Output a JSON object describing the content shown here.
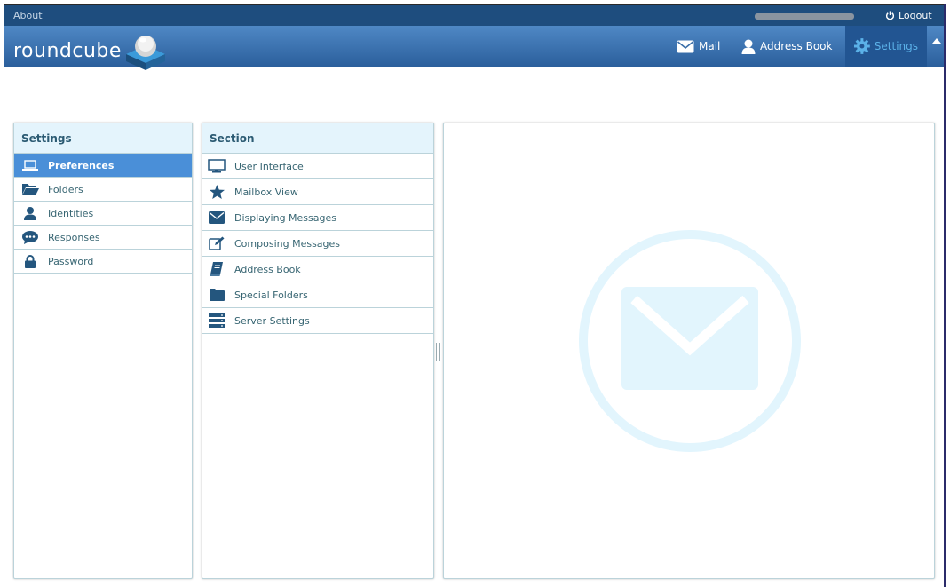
{
  "topline": {
    "about": "About",
    "logout": "Logout"
  },
  "header": {
    "logo_text": "roundcube",
    "nav": {
      "mail": "Mail",
      "addressbook": "Address Book",
      "settings": "Settings"
    }
  },
  "settings_panel": {
    "title": "Settings",
    "items": [
      {
        "label": "Preferences",
        "icon": "laptop-icon"
      },
      {
        "label": "Folders",
        "icon": "folder-open-icon"
      },
      {
        "label": "Identities",
        "icon": "user-icon"
      },
      {
        "label": "Responses",
        "icon": "chat-icon"
      },
      {
        "label": "Password",
        "icon": "lock-icon"
      }
    ]
  },
  "section_panel": {
    "title": "Section",
    "items": [
      {
        "label": "User Interface",
        "icon": "monitor-icon"
      },
      {
        "label": "Mailbox View",
        "icon": "star-icon"
      },
      {
        "label": "Displaying Messages",
        "icon": "envelope-icon"
      },
      {
        "label": "Composing Messages",
        "icon": "edit-icon"
      },
      {
        "label": "Address Book",
        "icon": "book-icon"
      },
      {
        "label": "Special Folders",
        "icon": "folder-icon"
      },
      {
        "label": "Server Settings",
        "icon": "server-icon"
      }
    ]
  },
  "colors": {
    "header": "#2b5f9c",
    "selected": "#4a8fd8",
    "panel_header": "#e4f4fc",
    "watermark": "#e2f5fd"
  }
}
